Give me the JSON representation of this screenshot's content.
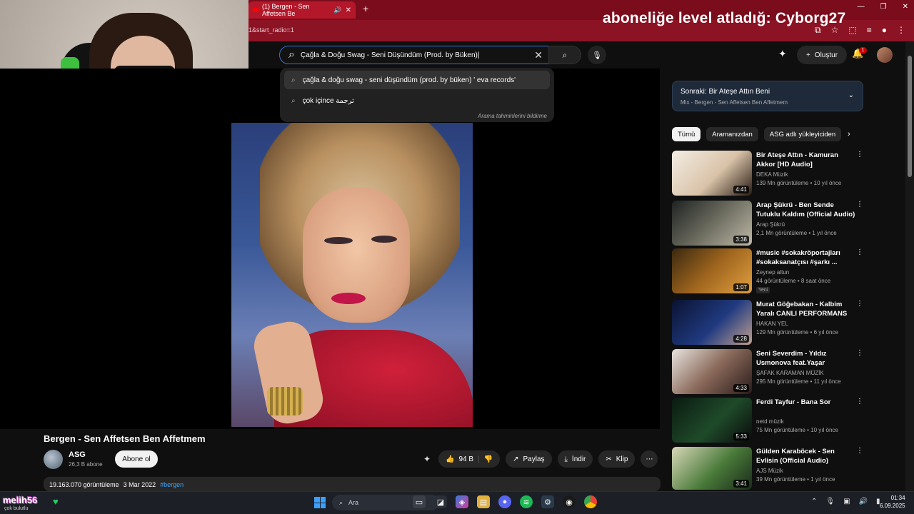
{
  "overlay": {
    "title": "aboneliğe level atladığ: Cyborg27"
  },
  "browser": {
    "tab_title": "(1) Bergen - Sen Affetsen Be",
    "address_fragment": "1&start_radio=1",
    "accent": "#b3172a"
  },
  "masthead": {
    "search_query": "Çağla & Doğu Swag - Seni Düşündüm (Prod. by Büken)|",
    "create_label": "Oluştur",
    "notification_count": "1"
  },
  "suggestions": {
    "items": [
      "çağla & doğu swag - seni düşündüm (prod. by büken) ' eva records'",
      "çok içince ترجمة"
    ],
    "footer": "Arama tahminlerini bildirme"
  },
  "video": {
    "title": "Bergen - Sen Affetsen Ben Affetmem",
    "channel": "ASG",
    "subscribers": "26,3 B abone",
    "subscribe_label": "Abone ol",
    "likes": "94 B",
    "share_label": "Paylaş",
    "download_label": "İndir",
    "clip_label": "Klip",
    "views": "19.163.070 görüntüleme",
    "date": "3 Mar 2022",
    "hashtag": "#bergen"
  },
  "up_next": {
    "title": "Sonraki: Bir Ateşe Attın Beni",
    "subtitle": "Mix - Bergen - Sen Affetsen Ben Affetmem"
  },
  "chips": [
    "Tümü",
    "Aramanızdan",
    "ASG adlı yükleyiciden"
  ],
  "recommendations": [
    {
      "title": "Bir Ateşe Attın - Kamuran Akkor [HD Audio]",
      "channel": "DEKA Müzik",
      "meta": "139 Mn görüntüleme • 10 yıl önce",
      "duration": "4:41",
      "badge": ""
    },
    {
      "title": "Arap Şükrü - Ben Sende Tutuklu Kaldım (Official Audio)",
      "channel": "Arap Şükrü",
      "meta": "2,1 Mn görüntüleme • 1 yıl önce",
      "duration": "3:38",
      "badge": ""
    },
    {
      "title": "#music #sokakröportajları #sokaksanatçısı #şarkı ...",
      "channel": "Zeynep altun",
      "meta": "44 görüntüleme • 8 saat önce",
      "duration": "1:07",
      "badge": "Yeni"
    },
    {
      "title": "Murat Göğebakan - Kalbim Yaralı CANLI PERFORMANS -...",
      "channel": "HAKAN YEL",
      "meta": "129 Mn görüntüleme • 6 yıl önce",
      "duration": "4:28",
      "badge": ""
    },
    {
      "title": "Seni Severdim - Yıldız Usmonova feat.Yaşar (Official...",
      "channel": "ŞAFAK KARAMAN MÜZİK",
      "meta": "295 Mn görüntüleme • 11 yıl önce",
      "duration": "4:33",
      "badge": ""
    },
    {
      "title": "Ferdi Tayfur - Bana Sor",
      "channel": "netd müzik",
      "meta": "75 Mn görüntüleme • 10 yıl önce",
      "duration": "5:33",
      "badge": ""
    },
    {
      "title": "Gülden Karaböcek - Sen Evlisin (Official Audio)",
      "channel": "AJS Müzik",
      "meta": "39 Mn görüntüleme • 1 yıl önce",
      "duration": "3:41",
      "badge": ""
    }
  ],
  "taskbar": {
    "chat_user": "melih56",
    "chat_sub": "çok bulutlu",
    "search_placeholder": "Ara",
    "time": "01:34",
    "date": "6.09.2025"
  }
}
